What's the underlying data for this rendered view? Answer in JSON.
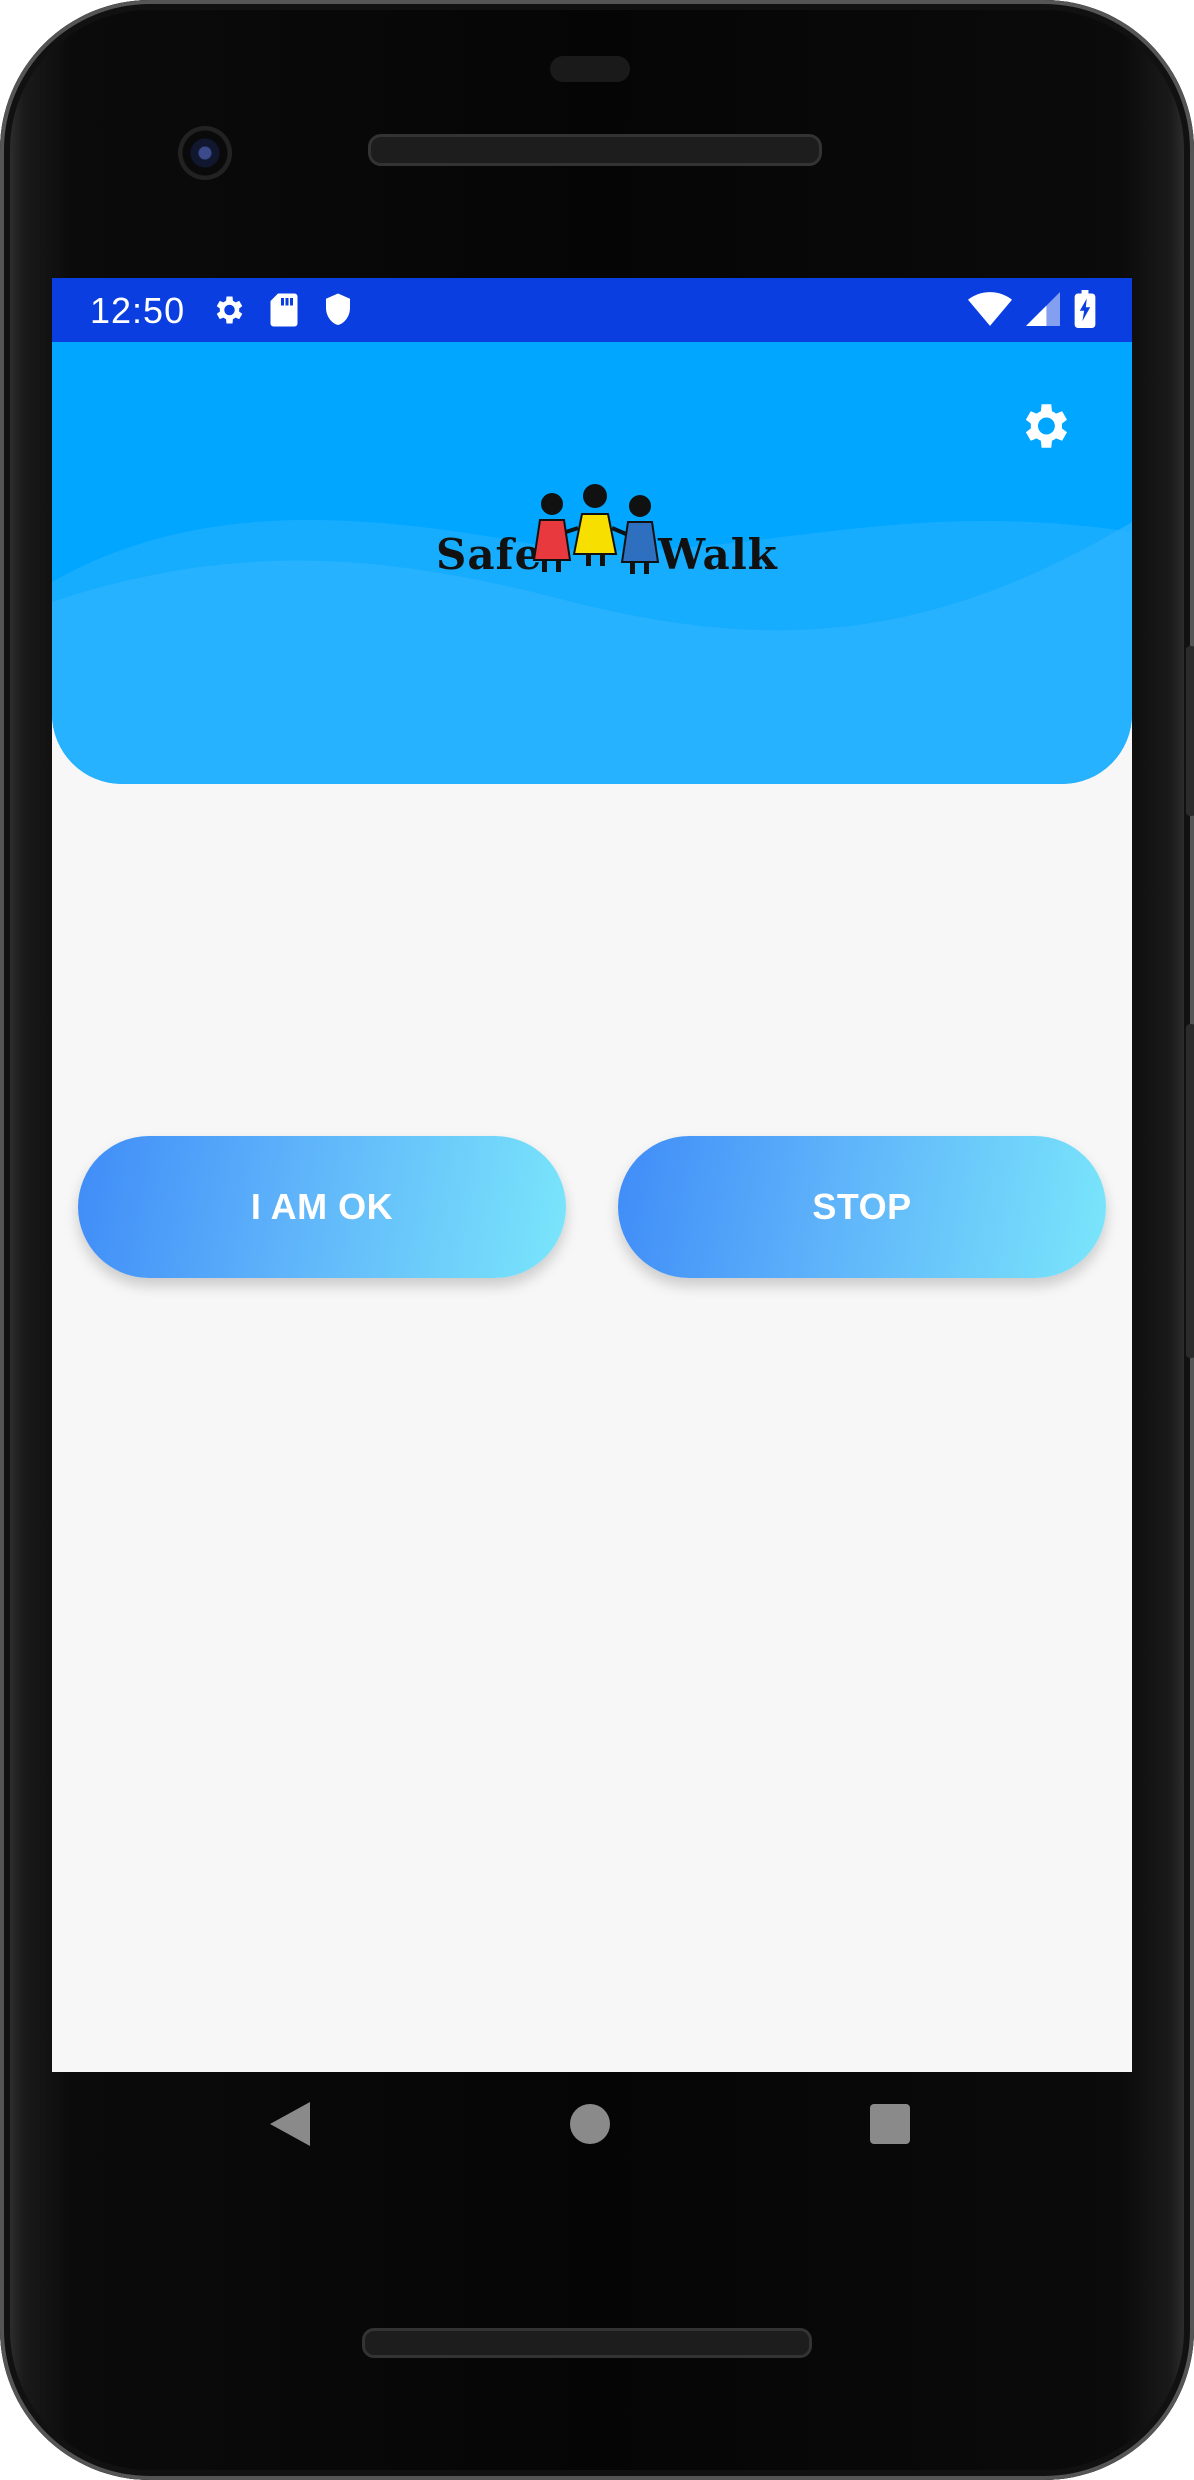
{
  "status_bar": {
    "time": "12:50",
    "left_icons": [
      "gear-icon",
      "sd-card-icon",
      "shield-icon"
    ],
    "right_icons": [
      "wifi-icon",
      "cellular-signal-icon",
      "battery-charging-icon"
    ]
  },
  "header": {
    "background_color": "#00a6ff",
    "settings_icon": "gear-icon",
    "logo": {
      "text_left": "Safe",
      "text_right": "Walk"
    }
  },
  "actions": {
    "ok_label": "I AM OK",
    "stop_label": "STOP"
  },
  "navigation": {
    "items": [
      "back-triangle-icon",
      "home-circle-icon",
      "recents-square-icon"
    ]
  },
  "colors": {
    "status_bar": "#0a3ee0",
    "screen_background": "#f7f7f7",
    "button_gradient_start": "#3f8cf8",
    "button_gradient_end": "#7ae6fb"
  }
}
